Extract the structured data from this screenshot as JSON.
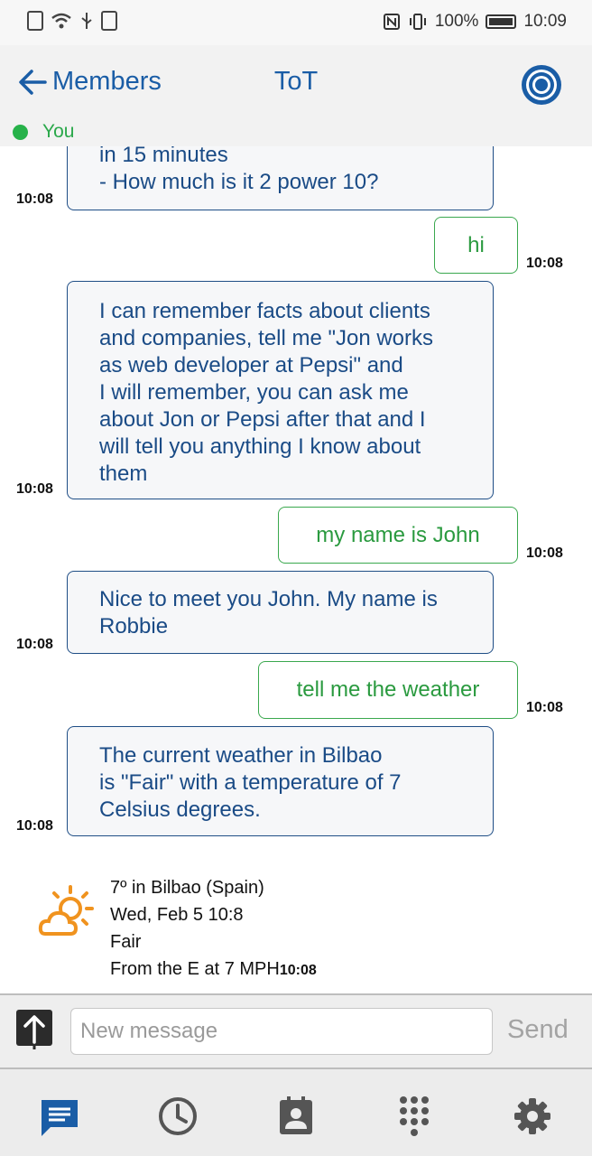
{
  "status_bar": {
    "battery": "100%",
    "time": "10:09"
  },
  "header": {
    "back_label": "Members",
    "title": "ToT",
    "presence_label": "You"
  },
  "messages": [
    {
      "from": "bot",
      "text": "in 15 minutes\n- How much is it 2 power 10?",
      "time": "10:08"
    },
    {
      "from": "me",
      "text": "hi",
      "time": "10:08"
    },
    {
      "from": "bot",
      "text": "I can remember facts about clients\nand companies, tell me \"Jon works\nas web developer at Pepsi\" and\nI will remember, you can ask me\nabout Jon or Pepsi after that and I\nwill tell you anything I know about\nthem",
      "time": "10:08"
    },
    {
      "from": "me",
      "text": "my name is John",
      "time": "10:08"
    },
    {
      "from": "bot",
      "text": "Nice to meet you John. My name is\nRobbie",
      "time": "10:08"
    },
    {
      "from": "me",
      "text": "tell me the weather",
      "time": "10:08"
    },
    {
      "from": "bot",
      "text": "The current weather in Bilbao\nis \"Fair\" with a temperature of 7\nCelsius degrees.",
      "time": "10:08"
    }
  ],
  "weather_card": {
    "icon": "partly-cloudy-sun-icon",
    "location": "7º in Bilbao (Spain)",
    "date": "Wed, Feb 5 10:8",
    "condition": "Fair",
    "wind": "From the E at 7 MPH",
    "time": "10:08"
  },
  "composer": {
    "placeholder": "New message",
    "send_label": "Send"
  },
  "bottom_nav": [
    "chat-icon",
    "history-clock-icon",
    "contacts-icon",
    "dialpad-icon",
    "settings-gear-icon"
  ],
  "colors": {
    "primary": "#1a5da6",
    "bot_text": "#1a4b86",
    "user_text": "#2a9a3f",
    "presence": "#27b24a",
    "weather_icon": "#f0931f"
  }
}
